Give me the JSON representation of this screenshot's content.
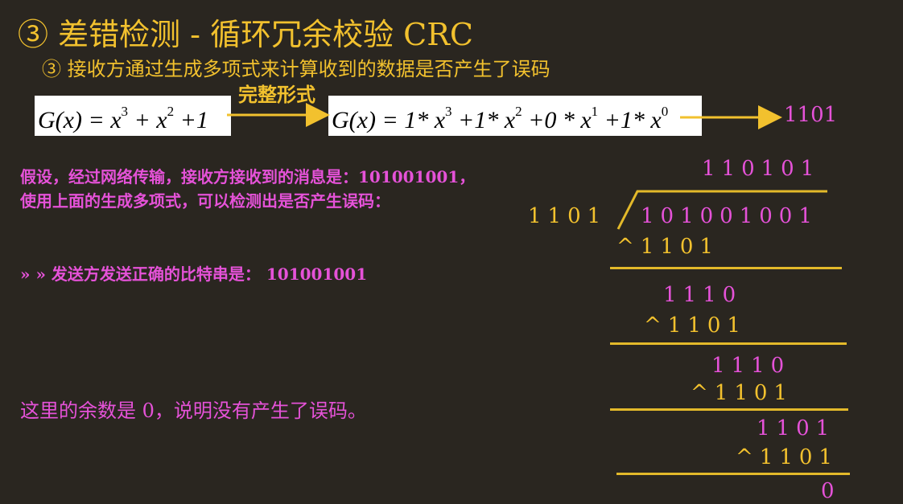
{
  "title": "③ 差错检测 - 循环冗余校验 CRC",
  "subtitle": "③ 接收方通过生成多项式来计算收到的数据是否产生了误码",
  "formula_short": {
    "lhs": "G(x) = x",
    "exp1": "3",
    "plus1": " + x",
    "exp2": "2",
    "tail": " +1"
  },
  "label_full_form": "完整形式",
  "formula_full": {
    "p1": "G(x) = 1* x",
    "e1": "3",
    "p2": " +1* x",
    "e2": "2",
    "p3": " +0 * x",
    "e3": "1",
    "p4": " +1* x",
    "e4": "0"
  },
  "binary_result": "1101",
  "assumption_line1": "假设，经过网络传输，接收方接收到的消息是：101001001，",
  "assumption_line2": "使用上面的生成多项式，可以检测出是否产生误码：",
  "sender_line": "» » 发送方发送正确的比特串是： 101001001",
  "conclusion": "这里的余数是 0，说明没有产生了误码。",
  "division": {
    "quotient": "110101",
    "divisor": "1101",
    "dividend": "101001001",
    "steps": [
      {
        "xor_mark": "^",
        "subtrahend": "1101",
        "remainder": "1110"
      },
      {
        "xor_mark": "^",
        "subtrahend": "1101",
        "remainder": "1110"
      },
      {
        "xor_mark": "^",
        "subtrahend": "1101",
        "remainder": "1101"
      },
      {
        "xor_mark": "^",
        "subtrahend": "1101",
        "remainder": "0"
      }
    ]
  },
  "colors": {
    "background": "#2a2620",
    "yellow": "#f2c12e",
    "pink": "#e552d8",
    "line": "#e3b92a"
  }
}
